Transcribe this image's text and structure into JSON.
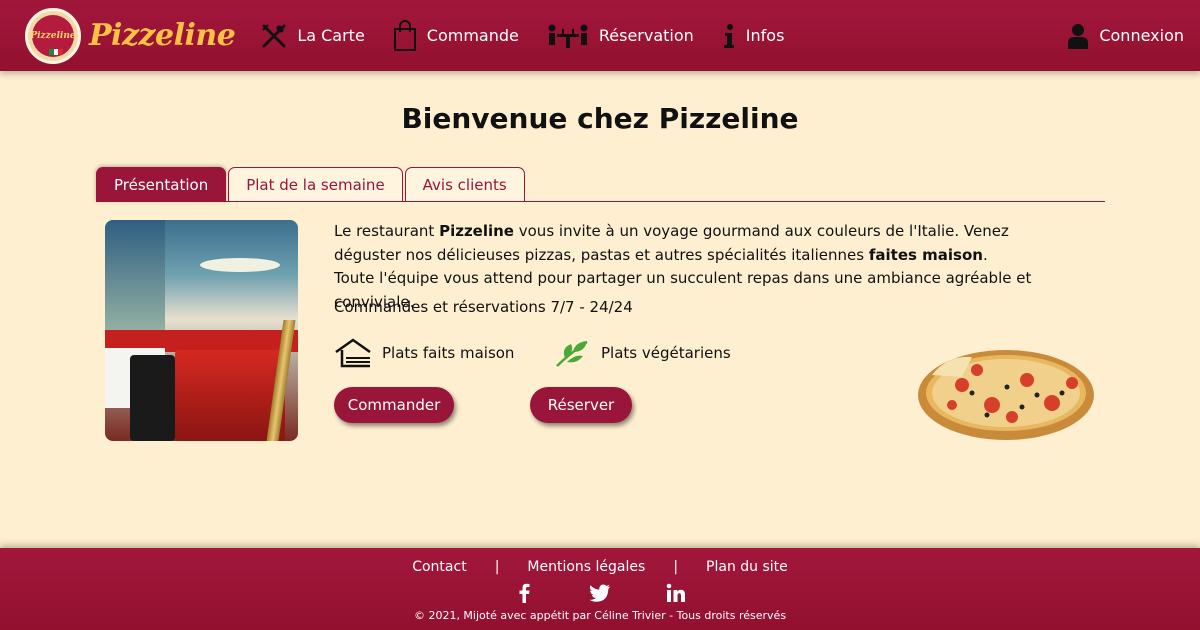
{
  "header": {
    "logo_text": "Pizzeline",
    "brand": "Pizzeline",
    "nav": [
      {
        "label": "La Carte",
        "icon": "cutlery-icon"
      },
      {
        "label": "Commande",
        "icon": "shopping-bag-icon"
      },
      {
        "label": "Réservation",
        "icon": "dining-table-icon"
      },
      {
        "label": "Infos",
        "icon": "info-icon"
      }
    ],
    "login": {
      "label": "Connexion",
      "icon": "user-icon"
    }
  },
  "main": {
    "title": "Bienvenue chez Pizzeline",
    "tabs": [
      {
        "label": "Présentation",
        "active": true
      },
      {
        "label": "Plat de la semaine",
        "active": false
      },
      {
        "label": "Avis clients",
        "active": false
      }
    ],
    "description": {
      "p1_a": "Le restaurant ",
      "p1_b": "Pizzeline",
      "p1_c": " vous invite à un voyage gourmand aux couleurs de l'Italie. Venez déguster nos délicieuses pizzas, pastas et autres spécialités italiennes ",
      "p1_d": "faites maison",
      "p1_e": ".",
      "p2": "Toute l'équipe vous attend pour partager un succulent repas dans une ambiance agréable et conviviale."
    },
    "hours": "Commandes et réservations 7/7 - 24/24",
    "features": [
      {
        "label": "Plats faits maison",
        "icon": "house-icon"
      },
      {
        "label": "Plats végétariens",
        "icon": "leaf-icon"
      }
    ],
    "buttons": {
      "order": "Commander",
      "book": "Réserver"
    }
  },
  "footer": {
    "links": [
      "Contact",
      "Mentions légales",
      "Plan du site"
    ],
    "separator": "|",
    "socials": [
      {
        "name": "facebook-icon",
        "glyph": "f"
      },
      {
        "name": "twitter-icon",
        "glyph": ""
      },
      {
        "name": "linkedin-icon",
        "glyph": "in"
      }
    ],
    "copyright": "© 2021, Mijoté avec appétit par Céline Trivier - Tous droits réservés"
  },
  "colors": {
    "brand": "#99153a",
    "background": "#ffefd1",
    "logo_yellow": "#ffc247"
  }
}
